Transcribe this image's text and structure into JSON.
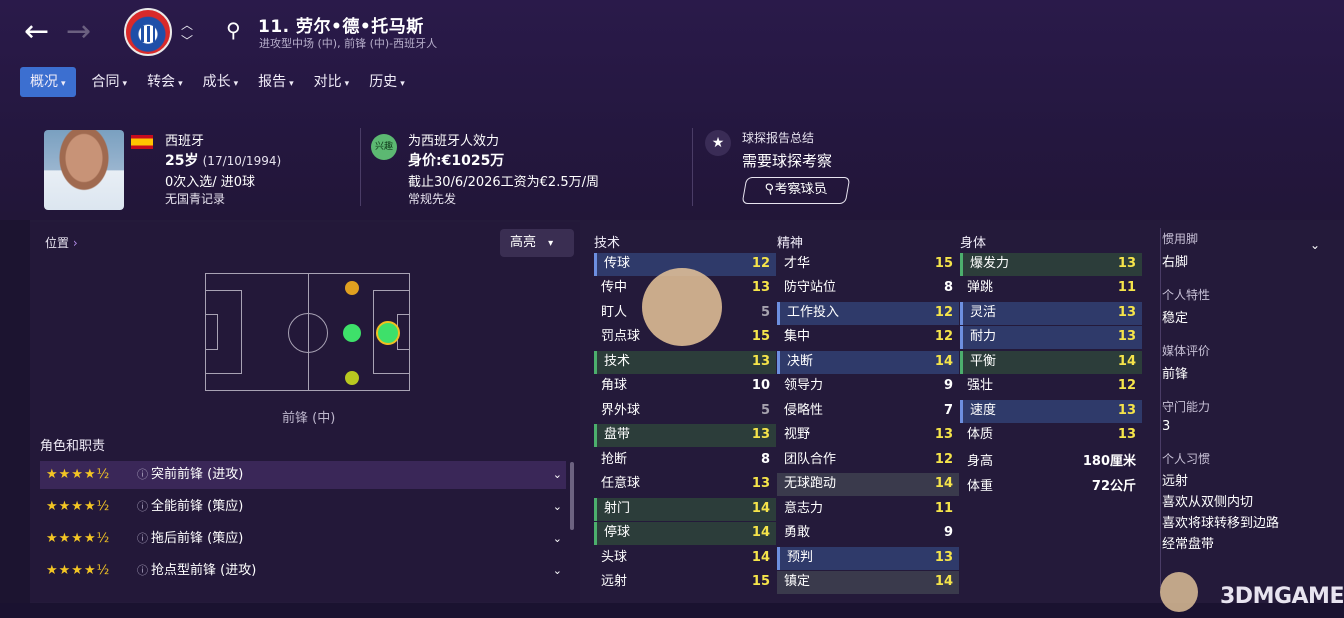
{
  "header": {
    "player_title": "11. 劳尔•德•托马斯",
    "player_subtitle": "进攻型中场 (中), 前锋 (中)-西班牙人"
  },
  "tabs": [
    {
      "label": "概况"
    },
    {
      "label": "合同"
    },
    {
      "label": "转会"
    },
    {
      "label": "成长"
    },
    {
      "label": "报告"
    },
    {
      "label": "对比"
    },
    {
      "label": "历史"
    }
  ],
  "profile": {
    "nation": "西班牙",
    "age": "25岁",
    "dob": "(17/10/1994)",
    "caps": "0次入选/ 进0球",
    "youth": "无国青记录",
    "club_badge": "兴趣",
    "plays_for": "为西班牙人效力",
    "value": "身价:€1025万",
    "contract": "截止30/6/2026工资为€2.5万/周",
    "squad_status": "常规先发",
    "scout_title": "球探报告总结",
    "scout_needed": "需要球探考察",
    "scout_button": "考察球员"
  },
  "position_panel": {
    "label": "位置",
    "highlight_button": "高亮",
    "position_name": "前锋 (中)",
    "roles_title": "角色和职责",
    "roles": [
      {
        "stars": "★★★★½",
        "name": "突前前锋 (进攻)"
      },
      {
        "stars": "★★★★½",
        "name": "全能前锋 (策应)"
      },
      {
        "stars": "★★★★½",
        "name": "拖后前锋 (策应)"
      },
      {
        "stars": "★★★★½",
        "name": "抢点型前锋 (进攻)"
      }
    ]
  },
  "attributes": {
    "technical": {
      "title": "技术",
      "items": [
        {
          "name": "传球",
          "value": "12"
        },
        {
          "name": "传中",
          "value": "13"
        },
        {
          "name": "盯人",
          "value": "5"
        },
        {
          "name": "罚点球",
          "value": "15"
        },
        {
          "name": "技术",
          "value": "13"
        },
        {
          "name": "角球",
          "value": "10"
        },
        {
          "name": "界外球",
          "value": "5"
        },
        {
          "name": "盘带",
          "value": "13"
        },
        {
          "name": "抢断",
          "value": "8"
        },
        {
          "name": "任意球",
          "value": "13"
        },
        {
          "name": "射门",
          "value": "14"
        },
        {
          "name": "停球",
          "value": "14"
        },
        {
          "name": "头球",
          "value": "14"
        },
        {
          "name": "远射",
          "value": "15"
        }
      ]
    },
    "mental": {
      "title": "精神",
      "items": [
        {
          "name": "才华",
          "value": "15"
        },
        {
          "name": "防守站位",
          "value": "8"
        },
        {
          "name": "工作投入",
          "value": "12"
        },
        {
          "name": "集中",
          "value": "12"
        },
        {
          "name": "决断",
          "value": "14"
        },
        {
          "name": "领导力",
          "value": "9"
        },
        {
          "name": "侵略性",
          "value": "7"
        },
        {
          "name": "视野",
          "value": "13"
        },
        {
          "name": "团队合作",
          "value": "12"
        },
        {
          "name": "无球跑动",
          "value": "14"
        },
        {
          "name": "意志力",
          "value": "11"
        },
        {
          "name": "勇敢",
          "value": "9"
        },
        {
          "name": "预判",
          "value": "13"
        },
        {
          "name": "镇定",
          "value": "14"
        }
      ]
    },
    "physical": {
      "title": "身体",
      "items": [
        {
          "name": "爆发力",
          "value": "13"
        },
        {
          "name": "弹跳",
          "value": "11"
        },
        {
          "name": "灵活",
          "value": "13"
        },
        {
          "name": "耐力",
          "value": "13"
        },
        {
          "name": "平衡",
          "value": "14"
        },
        {
          "name": "强壮",
          "value": "12"
        },
        {
          "name": "速度",
          "value": "13"
        },
        {
          "name": "体质",
          "value": "13"
        }
      ],
      "height_label": "身高",
      "height_value": "180厘米",
      "weight_label": "体重",
      "weight_value": "72公斤"
    }
  },
  "side_info": {
    "foot_label": "惯用脚",
    "foot_value": "右脚",
    "personality_label": "个人特性",
    "personality_value": "稳定",
    "media_label": "媒体评价",
    "media_value": "前锋",
    "gk_label": "守门能力",
    "gk_value": "3",
    "habits_label": "个人习惯",
    "habits": [
      "远射",
      "喜欢从双侧内切",
      "喜欢将球转移到边路",
      "经常盘带"
    ]
  },
  "watermark": "3DMGAME",
  "colors": {
    "accent": "#3c6fd0",
    "value_white": "#ffffff",
    "value_grey": "#a6a2ae",
    "value_yellow": "#f5e44a",
    "value_green": "#9be06a"
  }
}
